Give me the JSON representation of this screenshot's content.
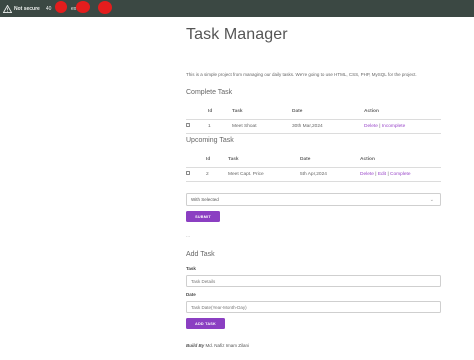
{
  "browser": {
    "security_label": "Not secure",
    "address_fragments": [
      "40",
      "1",
      "ex"
    ]
  },
  "page": {
    "title": "Task Manager",
    "intro": "This is a simple project from managing our daily tasks. We're going to use HTML, CSS, PHP, MySQL for the project."
  },
  "complete": {
    "heading": "Complete Task",
    "columns": [
      "Id",
      "Task",
      "Date",
      "Action"
    ],
    "rows": [
      {
        "id": "1",
        "task": "Meet Shoat",
        "date": "30th Mar,2024",
        "delete": "Delete",
        "sep": "|",
        "incomplete": "Incomplete"
      }
    ],
    "dots": "..."
  },
  "upcoming": {
    "heading": "Upcoming Task",
    "columns": [
      "Id",
      "Task",
      "Date",
      "Action"
    ],
    "rows": [
      {
        "id": "2",
        "task": "Meet Capt. Price",
        "date": "5th Apr,2024",
        "delete": "Delete",
        "edit": "Edit",
        "complete": "Complete",
        "sep": "|"
      }
    ]
  },
  "bulk": {
    "select_value": "With Selected",
    "submit_label": "SUBMIT",
    "dots": "..."
  },
  "add": {
    "heading": "Add Task",
    "task_label": "Task",
    "task_placeholder": "Task Details",
    "date_label": "Date",
    "date_placeholder": "Task Date(Year-Month-Day)",
    "button_label": "ADD TASK"
  },
  "footer": {
    "prefix": "Build By",
    "author": "Md. Nafiz Imam Zilani"
  }
}
